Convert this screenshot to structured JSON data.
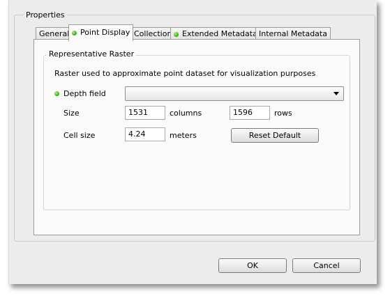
{
  "dialog": {
    "group_title": "Properties",
    "tabs": [
      {
        "label": "General",
        "indicator": false
      },
      {
        "label": "Point Display",
        "indicator": true
      },
      {
        "label": "Collection",
        "indicator": false
      },
      {
        "label": "Extended Metadata",
        "indicator": true
      },
      {
        "label": "Internal Metadata",
        "indicator": false
      }
    ],
    "active_tab": "Point Display"
  },
  "raster": {
    "group_title": "Representative Raster",
    "description": "Raster used to approximate point dataset for visualization purposes",
    "depth_field_label": "Depth field",
    "depth_field_value": "",
    "size_label": "Size",
    "columns_value": "1531",
    "columns_unit": "columns",
    "rows_value": "1596",
    "rows_unit": "rows",
    "cell_size_label": "Cell size",
    "cell_size_value": "4.24",
    "cell_size_unit": "meters",
    "reset_label": "Reset Default"
  },
  "footer": {
    "ok_label": "OK",
    "cancel_label": "Cancel"
  },
  "colors": {
    "indicator": "#2aa51c",
    "dialog_bg": "#ececec",
    "panel_bg": "#fbfbfb"
  }
}
